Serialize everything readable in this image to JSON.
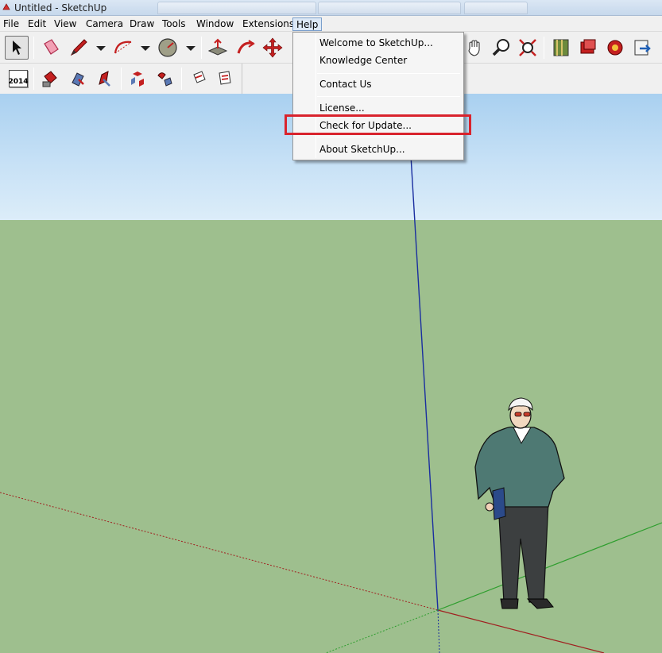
{
  "window": {
    "title": "Untitled - SketchUp"
  },
  "menubar": {
    "items": [
      "File",
      "Edit",
      "View",
      "Camera",
      "Draw",
      "Tools",
      "Window",
      "Extensions",
      "Help"
    ],
    "active": "Help"
  },
  "toolbar": {
    "year_label": "2014"
  },
  "help_menu": {
    "items": [
      "Welcome to SketchUp...",
      "Knowledge Center",
      "Contact Us",
      "License...",
      "Check for Update...",
      "About SketchUp..."
    ],
    "highlighted": "Check for Update..."
  },
  "colors": {
    "highlight_box": "#d9232d",
    "sky": "#b9d9f3",
    "ground": "#9ebf8e",
    "axis_blue": "#1a2ea0",
    "axis_red": "#a02020",
    "axis_green": "#2e9e2e"
  },
  "icons": [
    "select-arrow-icon",
    "eraser-icon",
    "pencil-icon",
    "arc-icon",
    "protractor-icon",
    "push-pull-icon",
    "follow-me-icon",
    "move-icon",
    "pan-hand-icon",
    "zoom-magnifier-icon",
    "zoom-extents-icon",
    "map-icon",
    "warehouse-icon",
    "extension-warehouse-icon",
    "share-model-icon"
  ]
}
